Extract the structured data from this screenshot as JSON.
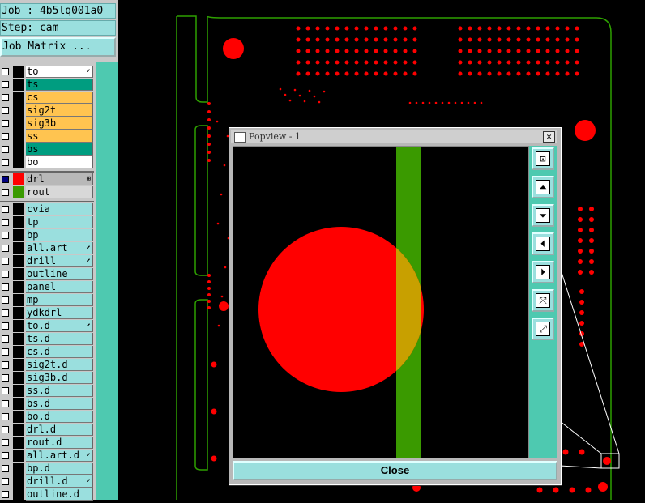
{
  "header": {
    "job_label": "Job : 4b5lq001a0",
    "step_label": "Step: cam",
    "job_matrix_button": "Job Matrix ..."
  },
  "colors": {
    "panel_cyan": "#9adfde",
    "teal": "#009d80",
    "yellow": "#ffc450",
    "pad_red": "#ff0000",
    "rout_green": "#3a9a00",
    "scroll_teal": "#4ec9b0"
  },
  "layers": [
    {
      "name": "to",
      "color": "#ffffff",
      "swatch": "#000000",
      "mark": true
    },
    {
      "name": "ts",
      "color": "#009d80",
      "swatch": "#000000"
    },
    {
      "name": "cs",
      "color": "#ffc450",
      "swatch": "#000000"
    },
    {
      "name": "sig2t",
      "color": "#ffc450",
      "swatch": "#000000"
    },
    {
      "name": "sig3b",
      "color": "#ffc450",
      "swatch": "#000000"
    },
    {
      "name": "ss",
      "color": "#ffc450",
      "swatch": "#000000"
    },
    {
      "name": "bs",
      "color": "#009d80",
      "swatch": "#000000"
    },
    {
      "name": "bo",
      "color": "#ffffff",
      "swatch": "#000000"
    }
  ],
  "active_layers": [
    {
      "name": "drl",
      "color": "#b8b8b8",
      "swatch": "#ff0000",
      "checked": true,
      "mark": "⊞"
    },
    {
      "name": "rout",
      "color": "#d8d8d8",
      "swatch": "#3a9a00",
      "checked": false
    }
  ],
  "other_layers": [
    {
      "name": "cvia",
      "mark": false
    },
    {
      "name": "tp",
      "mark": false
    },
    {
      "name": "bp",
      "mark": false
    },
    {
      "name": "all.art",
      "mark": true
    },
    {
      "name": "drill",
      "mark": true
    },
    {
      "name": "outline",
      "mark": false
    },
    {
      "name": "panel",
      "mark": false
    },
    {
      "name": "mp",
      "mark": false
    },
    {
      "name": "ydkdrl",
      "mark": false
    },
    {
      "name": "to.d",
      "mark": true
    },
    {
      "name": "ts.d",
      "mark": false
    },
    {
      "name": "cs.d",
      "mark": false
    },
    {
      "name": "sig2t.d",
      "mark": false
    },
    {
      "name": "sig3b.d",
      "mark": false
    },
    {
      "name": "ss.d",
      "mark": false
    },
    {
      "name": "bs.d",
      "mark": false
    },
    {
      "name": "bo.d",
      "mark": false
    },
    {
      "name": "drl.d",
      "mark": false
    },
    {
      "name": "rout.d",
      "mark": false
    },
    {
      "name": "all.art.d",
      "mark": true
    },
    {
      "name": "bp.d",
      "mark": false
    },
    {
      "name": "drill.d",
      "mark": true
    },
    {
      "name": "outline.d",
      "mark": false
    }
  ],
  "popview": {
    "title": "Popview - 1",
    "close_label": "Close",
    "close_x": "✕",
    "tools": [
      {
        "name": "zoom-home-icon"
      },
      {
        "name": "pan-up-icon"
      },
      {
        "name": "pan-down-icon"
      },
      {
        "name": "pan-left-icon"
      },
      {
        "name": "pan-right-icon"
      },
      {
        "name": "zoom-in-icon"
      },
      {
        "name": "zoom-out-icon"
      }
    ]
  }
}
